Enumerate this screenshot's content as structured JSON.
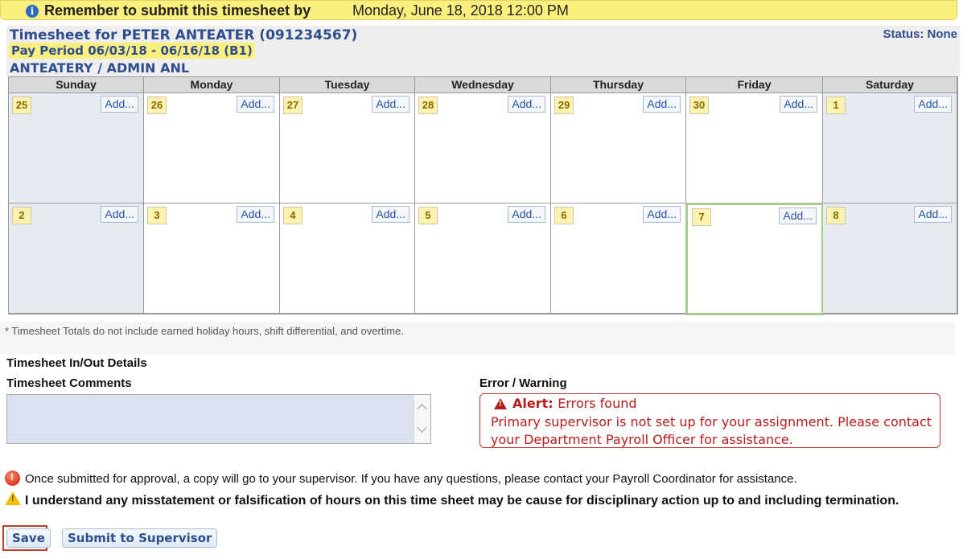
{
  "banner": {
    "prefix": "Remember to submit this timesheet by",
    "deadline": "Monday, June 18, 2018  12:00 PM"
  },
  "header": {
    "timesheet_for": "Timesheet for PETER ANTEATER (091234567)",
    "pay_period": "Pay Period 06/03/18 - 06/16/18 (B1)",
    "department": "ANTEATERY / ADMIN ANL",
    "status": "Status: None"
  },
  "calendar": {
    "days": [
      "Sunday",
      "Monday",
      "Tuesday",
      "Wednesday",
      "Thursday",
      "Friday",
      "Saturday"
    ],
    "add_label": "Add...",
    "weeks": [
      [
        "25",
        "26",
        "27",
        "28",
        "29",
        "30",
        "1"
      ],
      [
        "2",
        "3",
        "4",
        "5",
        "6",
        "7",
        "8"
      ]
    ],
    "selected_date": "7"
  },
  "note": "* Timesheet Totals do not include earned holiday hours, shift differential, and overtime.",
  "inout_title": "Timesheet In/Out Details",
  "comments": {
    "title": "Timesheet Comments",
    "value": ""
  },
  "error": {
    "title": "Error / Warning",
    "alert_label": "Alert:",
    "alert_summary": "Errors found",
    "message": "Primary supervisor is not set up for your assignment. Please contact your Department Payroll Officer for assistance."
  },
  "notices": {
    "approval": "Once submitted for approval, a copy will go to your supervisor. If you have any questions, please contact your Payroll Coordinator for assistance.",
    "acknowledge": "I understand any misstatement or falsification of hours on this time sheet may be cause for disciplinary action up to and including termination."
  },
  "buttons": {
    "save": "Save",
    "submit": "Submit to Supervisor"
  },
  "colors": {
    "banner": "#fbf07e",
    "header_text": "#2d4d8f",
    "alert": "#b71c1c",
    "selected_border": "#a8cc8c",
    "weekend_bg": "#e6ebf2"
  }
}
